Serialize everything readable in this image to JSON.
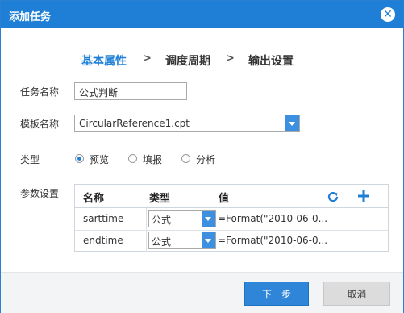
{
  "dialog": {
    "title": "添加任务",
    "close_icon": "close-icon",
    "steps": [
      "基本属性",
      "调度周期",
      "输出设置"
    ],
    "step_separator": ">"
  },
  "form": {
    "task_name_label": "任务名称",
    "task_name_value": "公式判断",
    "template_label": "模板名称",
    "template_value": "CircularReference1.cpt",
    "type_label": "类型",
    "type_options": [
      "预览",
      "填报",
      "分析"
    ],
    "type_selected": "预览",
    "params_label": "参数设置"
  },
  "params_table": {
    "headers": [
      "名称",
      "类型",
      "值"
    ],
    "rows": [
      {
        "name": "sarttime",
        "type": "公式",
        "value": "=Format(\"2010-06-0..."
      },
      {
        "name": "endtime",
        "type": "公式",
        "value": "=Format(\"2010-06-0..."
      }
    ],
    "icons": [
      "refresh-icon",
      "plus-icon"
    ]
  },
  "buttons": {
    "next": "下一步",
    "cancel": "取消"
  },
  "colors": {
    "accent": "#1f7fd6",
    "title_bg": "#1f7fd6",
    "footer_bg": "#f3f4f5",
    "cancel_bg": "#dcdcdc"
  }
}
